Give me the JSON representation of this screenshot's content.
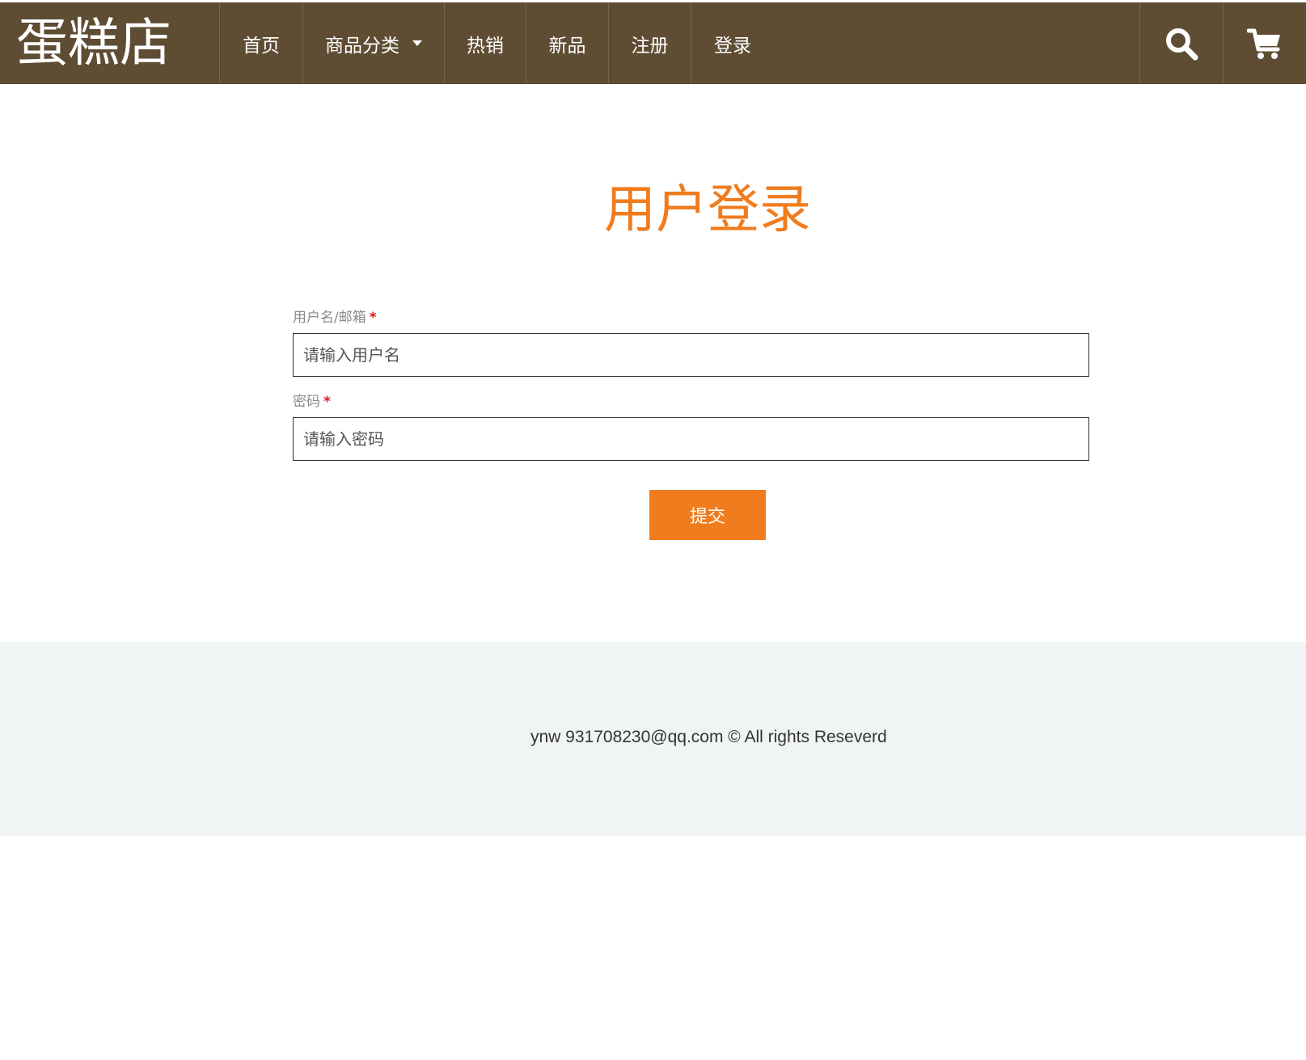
{
  "navbar": {
    "brand": "蛋糕店",
    "items": [
      {
        "label": "首页"
      },
      {
        "label": "商品分类",
        "has_dropdown": true
      },
      {
        "label": "热销"
      },
      {
        "label": "新品"
      },
      {
        "label": "注册"
      },
      {
        "label": "登录"
      }
    ],
    "icons": [
      "search-icon",
      "cart-icon"
    ],
    "background_color": "#5e4c33"
  },
  "main": {
    "title": "用户登录",
    "title_color": "#f07c1e",
    "username": {
      "label": "用户名/邮箱",
      "required_mark": "*",
      "placeholder": "请输入用户名",
      "value": ""
    },
    "password": {
      "label": "密码",
      "required_mark": "*",
      "placeholder": "请输入密码",
      "value": ""
    },
    "submit_label": "提交",
    "accent_color": "#f07c1e"
  },
  "footer": {
    "text": "ynw 931708230@qq.com © All rights Reseverd"
  }
}
